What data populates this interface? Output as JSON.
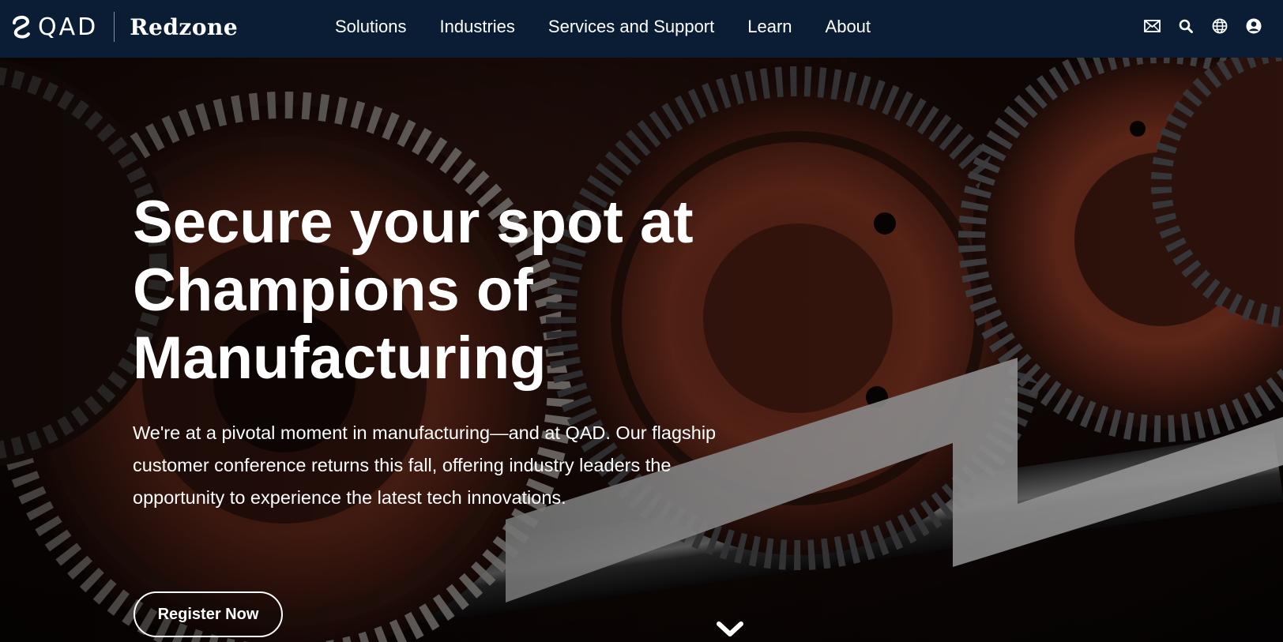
{
  "header": {
    "logo_primary": "QAD",
    "logo_secondary": "Redzone",
    "nav": [
      {
        "label": "Solutions"
      },
      {
        "label": "Industries"
      },
      {
        "label": "Services and Support"
      },
      {
        "label": "Learn"
      },
      {
        "label": "About"
      }
    ],
    "utility_icons": [
      "mail-icon",
      "search-icon",
      "globe-icon",
      "user-account-icon"
    ]
  },
  "hero": {
    "title": "Secure your spot at Champions of Manufacturing",
    "body": "We're at a pivotal moment in manufacturing—and at QAD. Our flagship customer conference returns this fall, offering industry leaders the opportunity to experience the latest tech innovations.",
    "cta_label": "Register Now",
    "scroll_icon": "chevron-down-icon"
  },
  "colors": {
    "header_bg": "#0b1d35",
    "text": "#ffffff",
    "gear_rust": "#7a2e1c",
    "accent_shape": "#c8c8c8"
  }
}
